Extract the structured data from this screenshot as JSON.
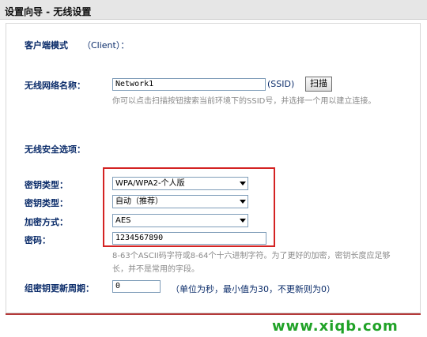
{
  "window": {
    "title": "设置向导 - 无线设置"
  },
  "client_mode": {
    "label": "客户端模式",
    "value": "（Client）："
  },
  "ssid": {
    "label": "无线网络名称：",
    "value": "Network1",
    "suffix": "(SSID)",
    "scan_button": "扫描",
    "hint": "你可以点击扫描按钮搜索当前环境下的SSID号，并选择一个用以建立连接。"
  },
  "security": {
    "title": "无线安全选项：",
    "key_type_label_1": "密钥类型：",
    "key_type_value_1": "WPA/WPA2-个人版",
    "key_type_label_2": "密钥类型：",
    "key_type_value_2": "自动（推荐）",
    "encryption_label": "加密方式：",
    "encryption_value": "AES",
    "password_label": "密码：",
    "password_value": "1234567890",
    "password_hint": "8-63个ASCII码字符或8-64个十六进制字符。为了更好的加密，密钥长度应足够长，并不是常用的字段。"
  },
  "group_key": {
    "label": "组密钥更新周期：",
    "value": "0",
    "note": "（单位为秒，最小值为30，不更新则为0）"
  },
  "watermark": {
    "text": "www.xiqb.com"
  },
  "colors": {
    "label_blue": "#0b2c6a",
    "highlight_red": "#d42323",
    "watermark_green": "#20a227"
  }
}
